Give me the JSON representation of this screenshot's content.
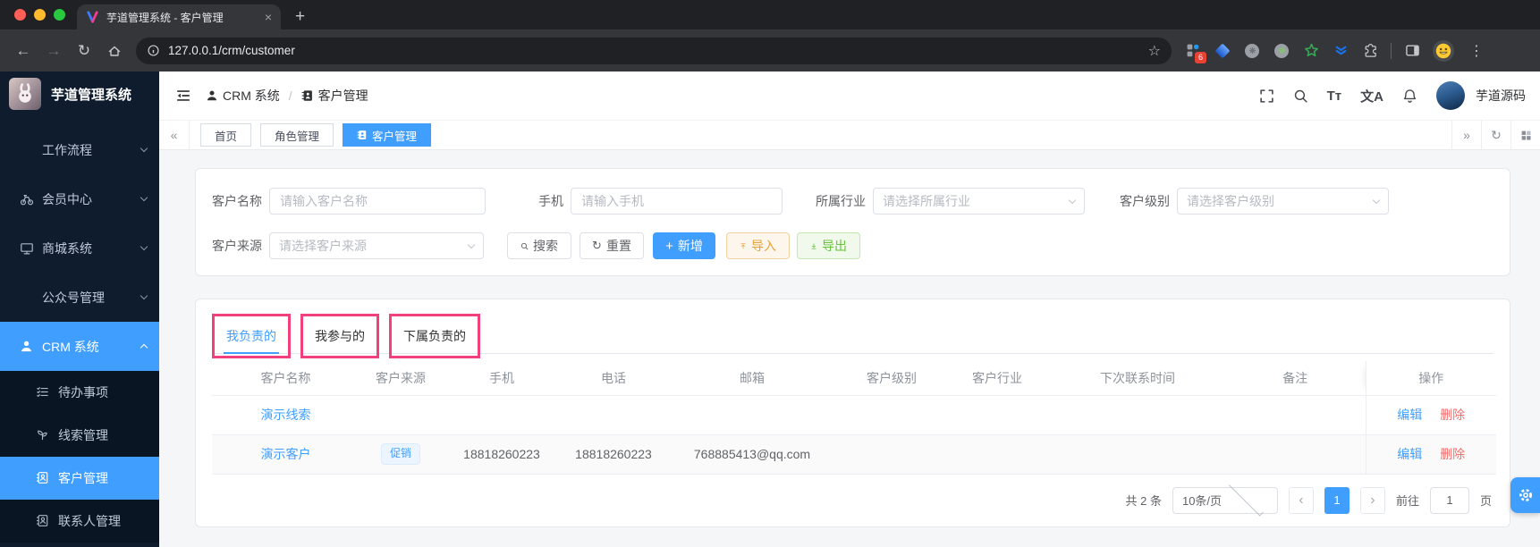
{
  "colors": {
    "accent": "#409eff",
    "danger": "#f56c6c",
    "annotation_pink": "#f2407e",
    "warning": "#e6a23c",
    "success": "#67c23a"
  },
  "icons": {
    "back": "←",
    "forward": "→",
    "reload": "↻",
    "star": "☆",
    "overflow": "⋮",
    "plus": "+",
    "close": "×",
    "collapse_left": "«",
    "expand_right": "»",
    "prev": "‹",
    "next": "›",
    "font_size": "Tт",
    "language": "文A"
  },
  "browser": {
    "tab_title": "芋道管理系统 - 客户管理",
    "url": "127.0.0.1/crm/customer",
    "ext_badge": "6"
  },
  "sidebar": {
    "logo_title": "芋道管理系统",
    "items": [
      {
        "label": "工作流程"
      },
      {
        "label": "会员中心"
      },
      {
        "label": "商城系统"
      },
      {
        "label": "公众号管理"
      },
      {
        "label": "CRM 系统"
      }
    ],
    "submenu": [
      {
        "label": "待办事项"
      },
      {
        "label": "线索管理"
      },
      {
        "label": "客户管理"
      },
      {
        "label": "联系人管理"
      }
    ]
  },
  "header": {
    "breadcrumb": [
      "CRM 系统",
      "客户管理"
    ],
    "separator": "/",
    "username": "芋道源码"
  },
  "tags": {
    "items": [
      "首页",
      "角色管理",
      "客户管理"
    ]
  },
  "filter": {
    "name_label": "客户名称",
    "name_placeholder": "请输入客户名称",
    "mobile_label": "手机",
    "mobile_placeholder": "请输入手机",
    "industry_label": "所属行业",
    "industry_placeholder": "请选择所属行业",
    "level_label": "客户级别",
    "level_placeholder": "请选择客户级别",
    "source_label": "客户来源",
    "source_placeholder": "请选择客户来源",
    "search": "搜索",
    "reset": "重置",
    "add": "新增",
    "import": "导入",
    "export": "导出"
  },
  "content_tabs": [
    {
      "label": "我负责的"
    },
    {
      "label": "我参与的"
    },
    {
      "label": "下属负责的"
    }
  ],
  "table": {
    "columns": [
      "客户名称",
      "客户来源",
      "手机",
      "电话",
      "邮箱",
      "客户级别",
      "客户行业",
      "下次联系时间",
      "备注",
      "操作"
    ],
    "rows": [
      {
        "name": "演示线索",
        "source_tag": "",
        "mobile": "",
        "phone": "",
        "email": "",
        "level": "",
        "industry": "",
        "next_time": "",
        "remark": "",
        "edit": "编辑",
        "delete": "删除"
      },
      {
        "name": "演示客户",
        "source_tag": "促销",
        "mobile": "18818260223",
        "phone": "18818260223",
        "email": "768885413@qq.com",
        "level": "",
        "industry": "",
        "next_time": "",
        "remark": "",
        "edit": "编辑",
        "delete": "删除"
      }
    ]
  },
  "pagination": {
    "total": "共 2 条",
    "page_size": "10条/页",
    "current": "1",
    "goto_label": "前往",
    "goto_value": "1",
    "page_unit": "页"
  }
}
